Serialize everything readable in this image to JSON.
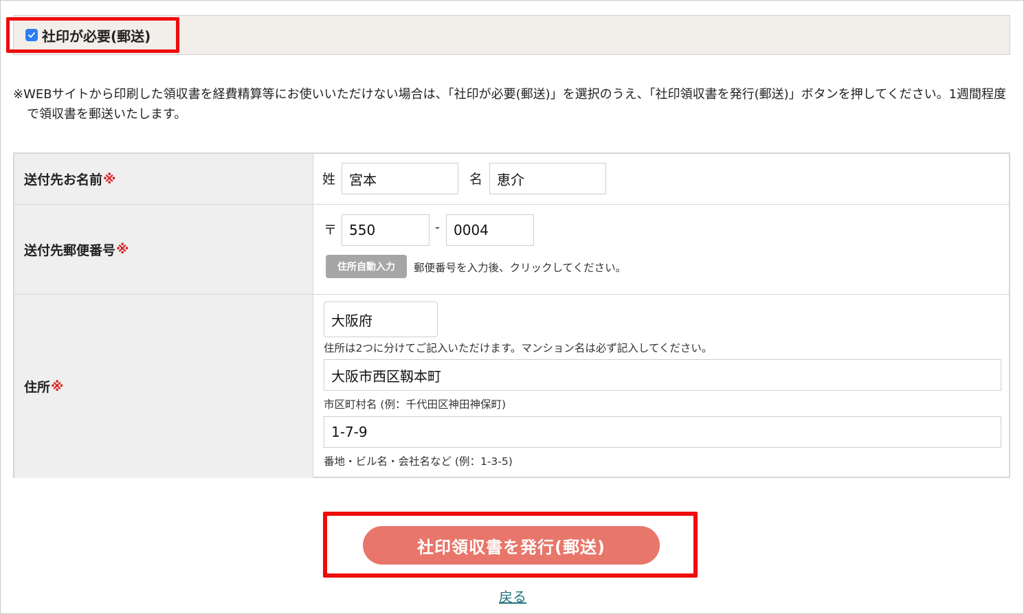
{
  "stamp": {
    "checked": true,
    "label": "社印が必要(郵送)"
  },
  "notice": "※WEBサイトから印刷した領収書を経費精算等にお使いいただけない場合は、「社印が必要(郵送)」を選択のうえ、「社印領収書を発行(郵送)」ボタンを押してください。1週間程度で領収書を郵送いたします。",
  "form": {
    "required_mark": "※",
    "name": {
      "label": "送付先お名前",
      "last_label": "姓",
      "last_value": "宮本",
      "first_label": "名",
      "first_value": "恵介"
    },
    "postal": {
      "label": "送付先郵便番号",
      "prefix": "〒",
      "part1": "550",
      "separator": "-",
      "part2": "0004",
      "auto_button": "住所自動入力",
      "hint": "郵便番号を入力後、クリックしてください。"
    },
    "address": {
      "label": "住所",
      "prefecture": "大阪府",
      "hint1": "住所は2つに分けてご記入いただけます。マンション名は必ず記入してください。",
      "city": "大阪市西区靱本町",
      "hint2": "市区町村名 (例：千代田区神田神保町)",
      "street": "1-7-9",
      "hint3": "番地・ビル名・会社名など (例：1-3-5)"
    }
  },
  "submit_label": "社印領収書を発行(郵送)",
  "back_label": "戻る",
  "colors": {
    "highlight": "#ef0c0c",
    "submit": "#e8766a",
    "checkbox": "#2c7df0",
    "link": "#22737c",
    "required": "#d62525"
  }
}
